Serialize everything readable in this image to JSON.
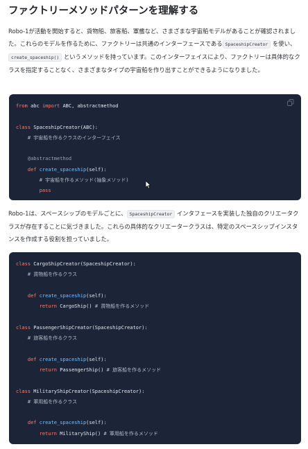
{
  "title": "ファクトリーメソッドパターンを理解する",
  "para1": {
    "t1": "Robo-1が活動を開始すると、貨物船、旅客船、軍艦など、さまざまな宇宙船モデルがあることが確認されました。これらのモデルを作るために、ファクトリーは共通のインターフェースである",
    "code_a": "SpaceshipCreator",
    "t2": " を使い、",
    "code_b": "create_spaceship()",
    "t3": " というメソッドを持っています。このインターフェイスにより、ファクトリーは具体的なクラスを指定することなく、さまざまなタイプの宇宙船を作り出すことができるようになりました。"
  },
  "para2": {
    "t1": "Robo-1は、スペースシップのモデルごとに、",
    "code_a": "SpaceshipCreator",
    "t2": " インタフェースを実装した独自のクリエータクラスが存在することに気づきました。これらの具体的なクリエータークラスは、特定のスペースシップインスタンスを作成する役割を担っていました。"
  },
  "code1": {
    "l1_kw1": "from",
    "l1_mod": " abc ",
    "l1_kw2": "import",
    "l1_rest": " ABC, abstractmethod",
    "l3_kw": "class",
    "l3_rest": " SpaceshipCreator(ABC):",
    "l4_cm": "# 宇宙船を作るクラスのインターフェイス",
    "l6_dec": "@abstractmethod",
    "l7_kw": "def",
    "l7_fn": "create_spaceship",
    "l7_rest": "(self):",
    "l8_cm": "# 宇宙船を作るメソッド(抽象メソッド)",
    "l9_kw": "pass"
  },
  "code2": {
    "c1_kw": "class",
    "c1_rest": " CargoShipCreator(SpaceshipCreator):",
    "c1_cm": "# 貨物船を作るクラス",
    "c1_def": "def",
    "c1_fn": "create_spaceship",
    "c1_args": "(self):",
    "c1_ret": "return",
    "c1_val": " CargoShip() ",
    "c1_cm2": "# 貨物船を作るメソッド",
    "c2_kw": "class",
    "c2_rest": " PassengerShipCreator(SpaceshipCreator):",
    "c2_cm": "# 旅客船を作るクラス",
    "c2_def": "def",
    "c2_fn": "create_spaceship",
    "c2_args": "(self):",
    "c2_ret": "return",
    "c2_val": " PassengerShip() ",
    "c2_cm2": "# 旅客船を作るメソッド",
    "c3_kw": "class",
    "c3_rest": " MilitaryShipCreator(SpaceshipCreator):",
    "c3_cm": "# 軍用船を作るクラス",
    "c3_def": "def",
    "c3_fn": "create_spaceship",
    "c3_args": "(self):",
    "c3_ret": "return",
    "c3_val": " MilitaryShip() ",
    "c3_cm2": "# 軍用船を作るメソッド"
  },
  "icons": {
    "copy": "copy-icon",
    "cursor": "mouse-pointer-icon"
  },
  "colors": {
    "code_bg": "#1b2537",
    "keyword": "#ff7b72",
    "function": "#79c0ff"
  }
}
